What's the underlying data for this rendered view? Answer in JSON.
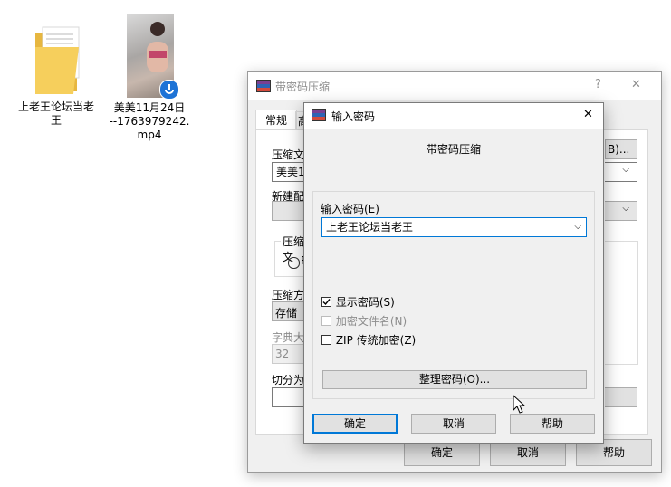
{
  "desktop": {
    "folder_label_line1": "上老王论坛当老",
    "folder_label_line2": "王",
    "video_label_line1": "美美11月24日",
    "video_label_line2": "--1763979242.",
    "video_label_line3": "mp4"
  },
  "back_dialog": {
    "title": "带密码压缩",
    "help_glyph": "?",
    "close_glyph": "✕",
    "tab_general": "常规",
    "tab_partial": "高",
    "label_archive_name": "压缩文",
    "archive_value": "美美1",
    "browse_label": "B)...",
    "label_update": "新建配",
    "group_format": "压缩文",
    "radio_partial": "R",
    "label_method": "压缩方",
    "method_value": "存储",
    "label_dict": "字典大",
    "dict_value": "32",
    "label_split": "切分为",
    "ok": "确定",
    "cancel": "取消",
    "help": "帮助"
  },
  "front_dialog": {
    "title": "输入密码",
    "close_glyph": "✕",
    "heading": "带密码压缩",
    "password_label": "输入密码(E)",
    "password_value": "上老王论坛当老王",
    "show_password": "显示密码(S)",
    "encrypt_names": "加密文件名(N)",
    "zip_legacy": "ZIP 传统加密(Z)",
    "organize": "整理密码(O)...",
    "ok": "确定",
    "cancel": "取消",
    "help": "帮助",
    "show_password_checked": true,
    "encrypt_names_enabled": false,
    "zip_legacy_checked": false
  }
}
